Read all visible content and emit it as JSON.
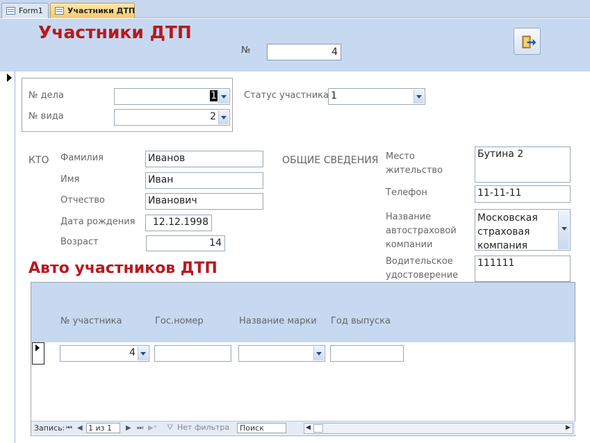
{
  "tabs": [
    {
      "label": "Form1"
    },
    {
      "label": "Участники ДТП"
    }
  ],
  "header": {
    "title": "Участники ДТП",
    "no_label": "№",
    "no_value": "4",
    "exit_icon": "exit-door-icon"
  },
  "case": {
    "delo_label": "№ дела",
    "delo_value": "1",
    "vid_label": "№ вида",
    "vid_value": "2",
    "status_label": "Статус участника",
    "status_value": "1"
  },
  "person": {
    "section": "КТО",
    "surname_label": "Фамилия",
    "surname_value": "Иванов",
    "name_label": "Имя",
    "name_value": "Иван",
    "patronymic_label": "Отчество",
    "patronymic_value": "Иванович",
    "dob_label": "Дата рождения",
    "dob_value": "12.12.1998",
    "age_label": "Возраст",
    "age_value": "14"
  },
  "general": {
    "section": "ОБЩИЕ СВЕДЕНИЯ",
    "address_label": "Место жительство",
    "address_value": "Бутина 2",
    "phone_label": "Телефон",
    "phone_value": "11-11-11",
    "insurer_label": "Название автостраховой компании",
    "insurer_value": "Московская страховая компания",
    "license_label": "Водительское удостоверение",
    "license_value": "111111"
  },
  "subform": {
    "title": "Авто участников ДТП",
    "columns": [
      "№ участника",
      "Гос.номер",
      "Название марки",
      "Год выпуска"
    ],
    "row": {
      "participant": "4",
      "plate": "",
      "brand": "",
      "year": ""
    }
  },
  "navbar": {
    "records_label": "Запись:",
    "position": "1 из 1",
    "filter_label": "Нет фильтра",
    "search_placeholder": "Поиск"
  },
  "colors": {
    "title_red": "#b8181e",
    "header_blue": "#c6d9f0"
  }
}
